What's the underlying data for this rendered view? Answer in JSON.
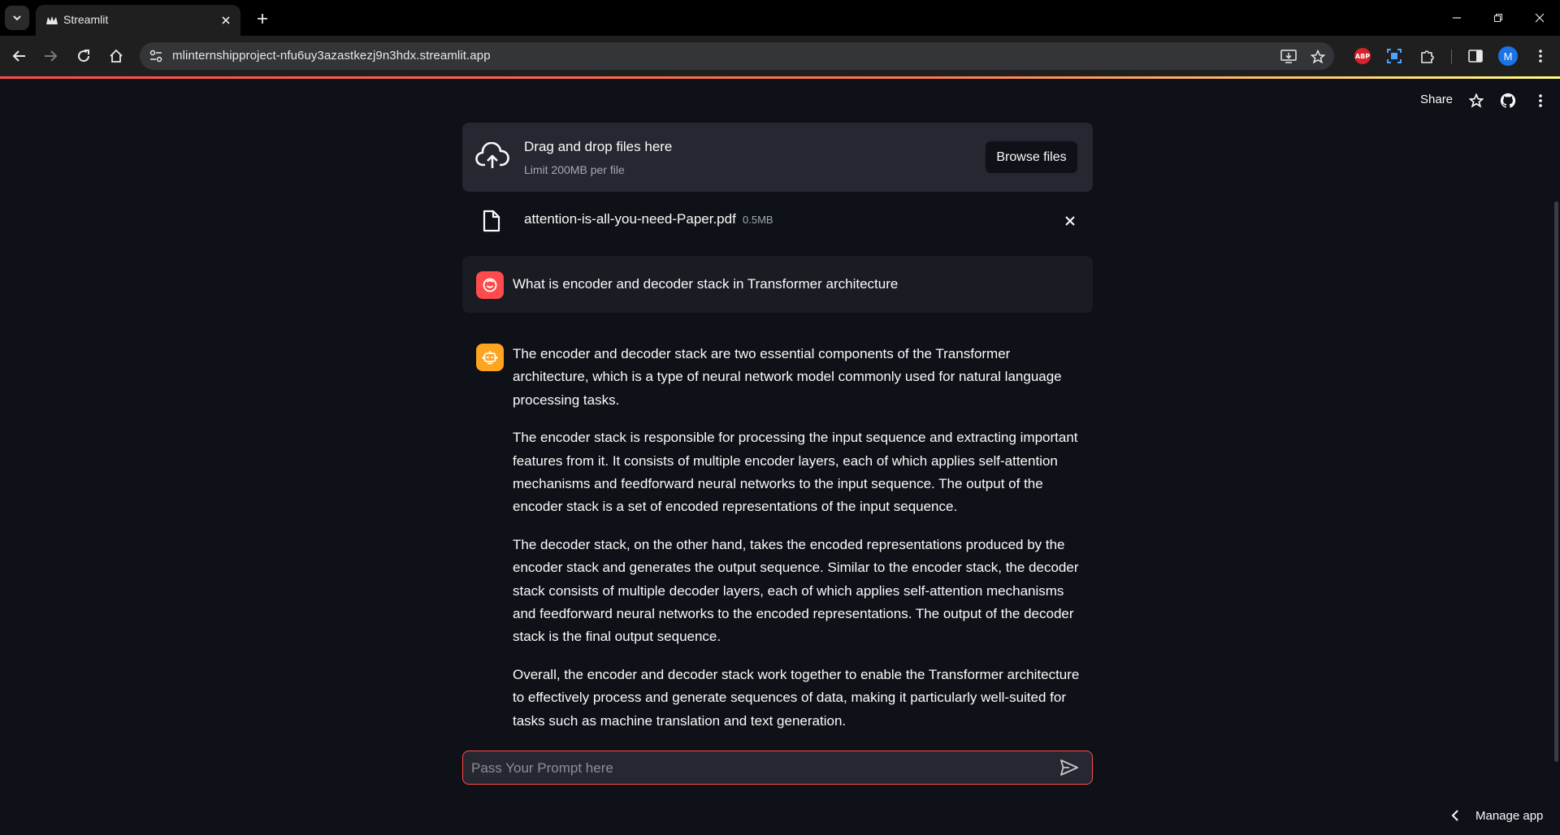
{
  "browser": {
    "tab_title": "Streamlit",
    "url": "mlinternshipproject-nfu6uy3azastkezj9n3hdx.streamlit.app",
    "avatar_letter": "M",
    "abp_label": "ABP"
  },
  "header": {
    "share_label": "Share"
  },
  "uploader": {
    "title": "Drag and drop files here",
    "limit": "Limit 200MB per file",
    "browse_label": "Browse files"
  },
  "file": {
    "name": "attention-is-all-you-need-Paper.pdf",
    "size": "0.5MB"
  },
  "chat": {
    "user_message": "What is encoder and decoder stack in Transformer architecture",
    "assistant_paragraphs": [
      "The encoder and decoder stack are two essential components of the Transformer architecture, which is a type of neural network model commonly used for natural language processing tasks.",
      "The encoder stack is responsible for processing the input sequence and extracting important features from it. It consists of multiple encoder layers, each of which applies self-attention mechanisms and feedforward neural networks to the input sequence. The output of the encoder stack is a set of encoded representations of the input sequence.",
      "The decoder stack, on the other hand, takes the encoded representations produced by the encoder stack and generates the output sequence. Similar to the encoder stack, the decoder stack consists of multiple decoder layers, each of which applies self-attention mechanisms and feedforward neural networks to the encoded representations. The output of the decoder stack is the final output sequence.",
      "Overall, the encoder and decoder stack work together to enable the Transformer architecture to effectively process and generate sequences of data, making it particularly well-suited for tasks such as machine translation and text generation."
    ],
    "input_placeholder": "Pass Your Prompt here",
    "input_value": ""
  },
  "footer": {
    "manage_label": "Manage app"
  },
  "colors": {
    "background": "#0e1117",
    "secondary_background": "#262730",
    "primary": "#ff4b4b",
    "assistant_avatar": "#ffa421",
    "text": "#fafafa"
  }
}
